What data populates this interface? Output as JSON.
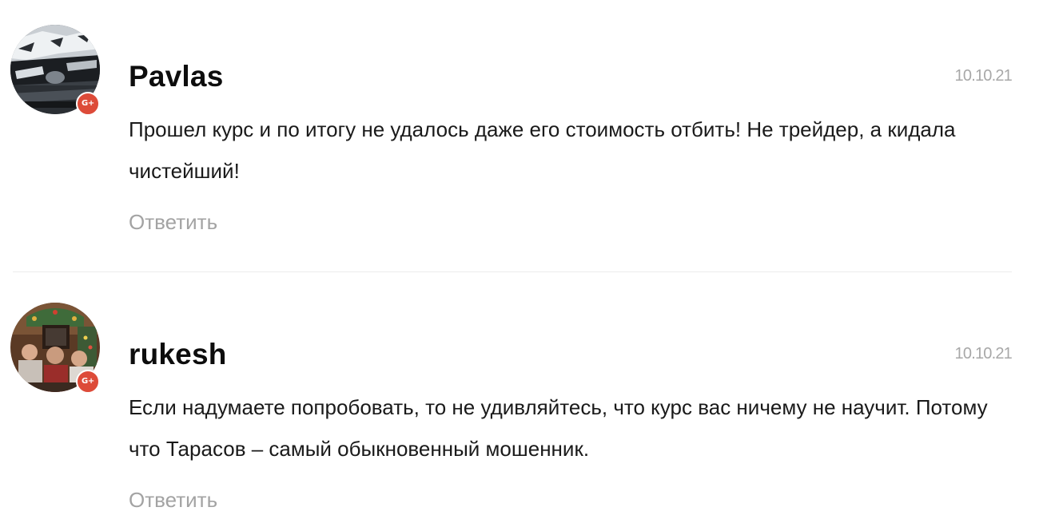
{
  "comments": [
    {
      "author": "Pavlas",
      "date": "10.10.21",
      "text": "Прошел курс и по итогу не удалось даже его стоимость отбить! Не трейдер, а кидала чистейший!",
      "reply_label": "Ответить",
      "avatar_icon": "car-photo-avatar",
      "badge": "G+"
    },
    {
      "author": "rukesh",
      "date": "10.10.21",
      "text": "Если надумаете попробовать, то не удивляйтесь, что курс вас ничему не научит. Потому что Тарасов – самый обыкновенный мошенник.",
      "reply_label": "Ответить",
      "avatar_icon": "group-photo-avatar",
      "badge": "G+"
    }
  ],
  "colors": {
    "badge": "#dd4b39",
    "reply": "#a3a3a3",
    "date": "#a8a8a8",
    "divider": "#ececec"
  }
}
